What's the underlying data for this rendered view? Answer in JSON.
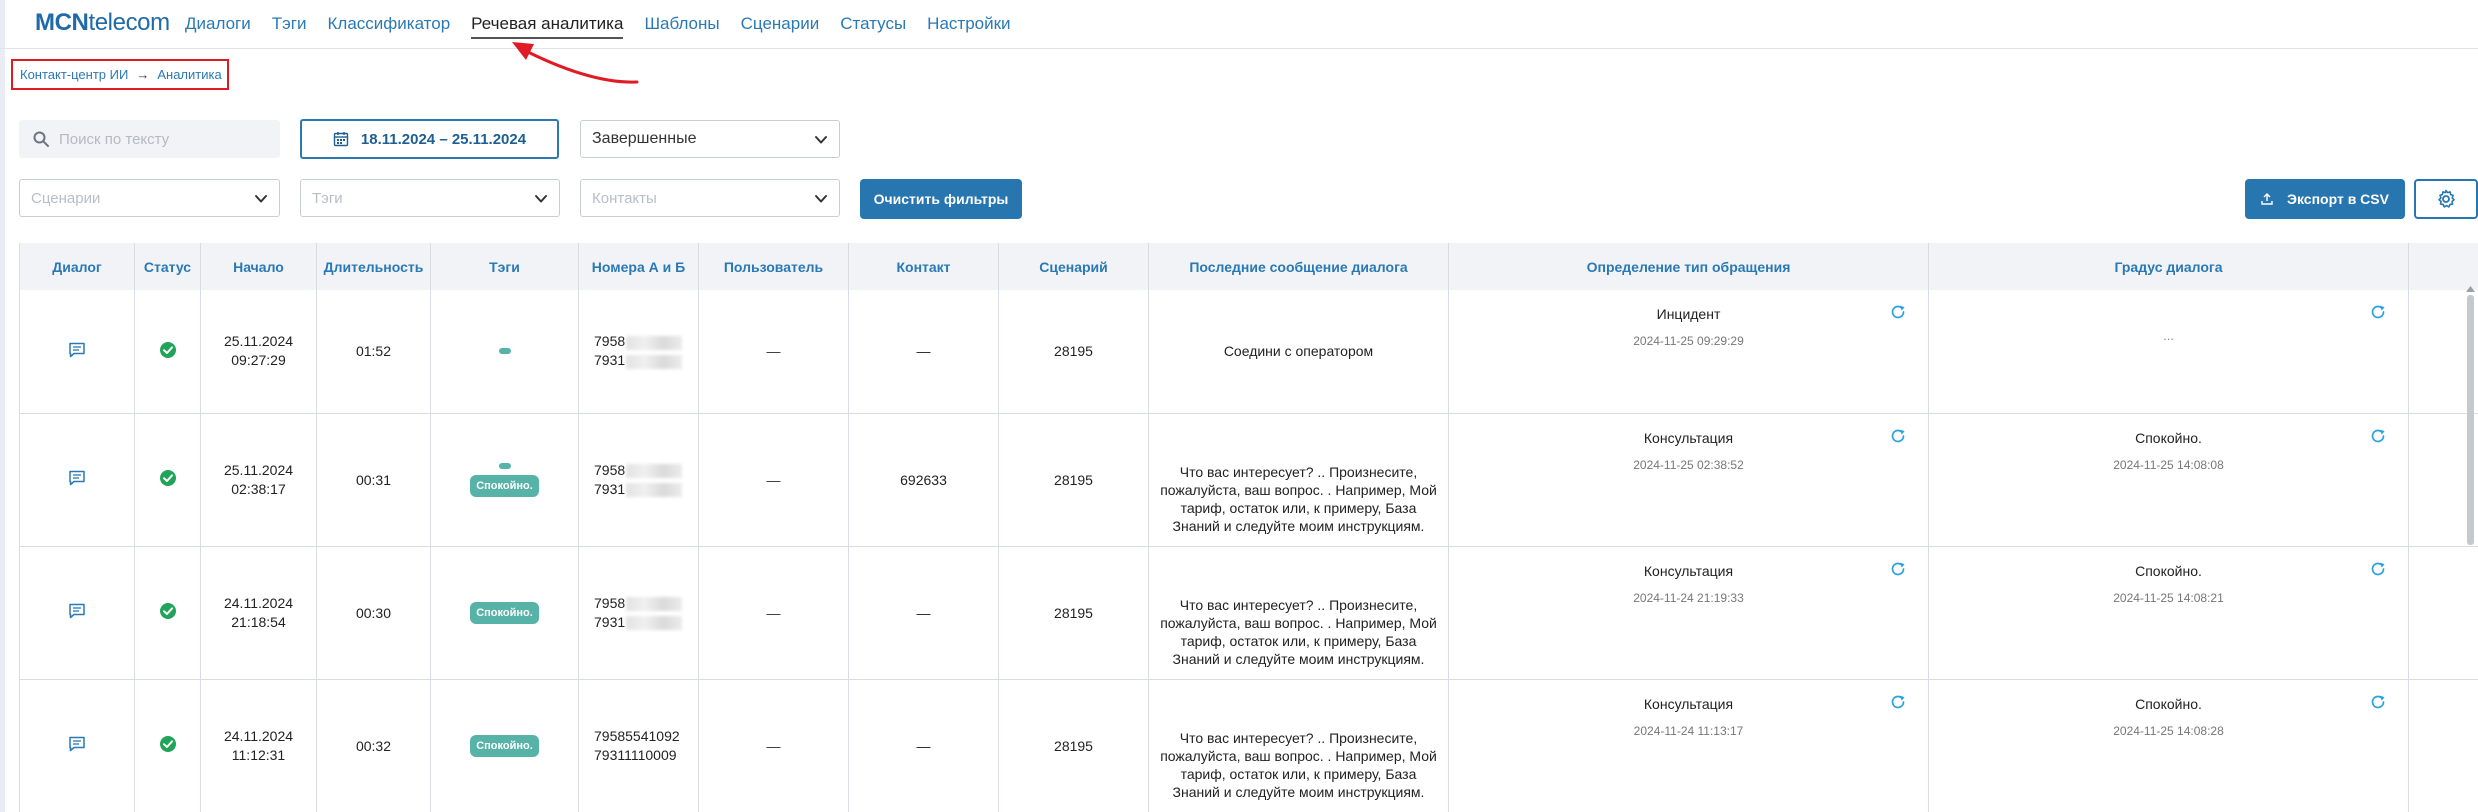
{
  "app": {
    "logo_bold": "MCN",
    "logo_rest": "telecom"
  },
  "nav": {
    "items": [
      "Диалоги",
      "Тэги",
      "Классификатор",
      "Речевая аналитика",
      "Шаблоны",
      "Сценарии",
      "Статусы",
      "Настройки"
    ],
    "active": "Речевая аналитика"
  },
  "breadcrumb": {
    "items": [
      "Контакт-центр ИИ",
      "Аналитика"
    ],
    "separator": "→"
  },
  "filters": {
    "search_placeholder": "Поиск по тексту",
    "date_range": "18.11.2024 – 25.11.2024",
    "status_value": "Завершенные",
    "scenarios_placeholder": "Сценарии",
    "tags_placeholder": "Тэги",
    "contacts_placeholder": "Контакты",
    "clear_button": "Очистить фильтры",
    "export_button": "Экспорт в CSV"
  },
  "table": {
    "columns": [
      "Диалог",
      "Статус",
      "Начало",
      "Длительность",
      "Тэги",
      "Номера А и Б",
      "Пользователь",
      "Контакт",
      "Сценарий",
      "Последние сообщение диалога",
      "Определение тип обращения",
      "Градус диалога"
    ],
    "rows": [
      {
        "start_date": "25.11.2024",
        "start_time": "09:27:29",
        "duration": "01:52",
        "tag": "",
        "number_a": "7958",
        "number_b": "7931",
        "numbers_masked": true,
        "user": "—",
        "contact": "—",
        "scenario": "28195",
        "last_message": "Соедини с оператором",
        "type_value": "Инцидент",
        "type_time": "2024-11-25 09:29:29",
        "mood_value": "",
        "mood_time": "...",
        "mood_empty": true
      },
      {
        "start_date": "25.11.2024",
        "start_time": "02:38:17",
        "duration": "00:31",
        "tag": "Спокойно.",
        "number_a": "7958",
        "number_b": "7931",
        "numbers_masked": true,
        "user": "—",
        "contact": "692633",
        "scenario": "28195",
        "last_message": "Что вас интересует? .. Произнесите, пожалуйста, ваш вопрос. . Например, Мой тариф, остаток или, к примеру, База Знаний и следуйте моим инструкциям.",
        "type_value": "Консультация",
        "type_time": "2024-11-25 02:38:52",
        "mood_value": "Спокойно.",
        "mood_time": "2024-11-25 14:08:08",
        "mood_empty": false
      },
      {
        "start_date": "24.11.2024",
        "start_time": "21:18:54",
        "duration": "00:30",
        "tag": "Спокойно.",
        "number_a": "7958",
        "number_b": "7931",
        "numbers_masked": true,
        "user": "—",
        "contact": "—",
        "scenario": "28195",
        "last_message": "Что вас интересует? .. Произнесите, пожалуйста, ваш вопрос. . Например, Мой тариф, остаток или, к примеру, База Знаний и следуйте моим инструкциям.",
        "type_value": "Консультация",
        "type_time": "2024-11-24 21:19:33",
        "mood_value": "Спокойно.",
        "mood_time": "2024-11-25 14:08:21",
        "mood_empty": false
      },
      {
        "start_date": "24.11.2024",
        "start_time": "11:12:31",
        "duration": "00:32",
        "tag": "Спокойно.",
        "number_a": "79585541092",
        "number_b": "79311110009",
        "numbers_masked": false,
        "user": "—",
        "contact": "—",
        "scenario": "28195",
        "last_message": "Что вас интересует? .. Произнесите, пожалуйста, ваш вопрос. . Например, Мой тариф, остаток или, к примеру, База Знаний и следуйте моим инструкциям.",
        "type_value": "Консультация",
        "type_time": "2024-11-24 11:13:17",
        "mood_value": "Спокойно.",
        "mood_time": "2024-11-25 14:08:28",
        "mood_empty": false
      }
    ]
  },
  "colors": {
    "accent": "#2776b0",
    "link": "#2a79b5",
    "status_ok": "#21a45a",
    "tag": "#57b3a8",
    "annotation": "#e01b24"
  },
  "icons": {
    "dialog": "chat-bubble-icon",
    "status": "check-circle-icon",
    "refresh": "refresh-icon",
    "search": "search-icon",
    "calendar": "calendar-icon",
    "export": "upload-icon",
    "settings": "gear-icon"
  }
}
